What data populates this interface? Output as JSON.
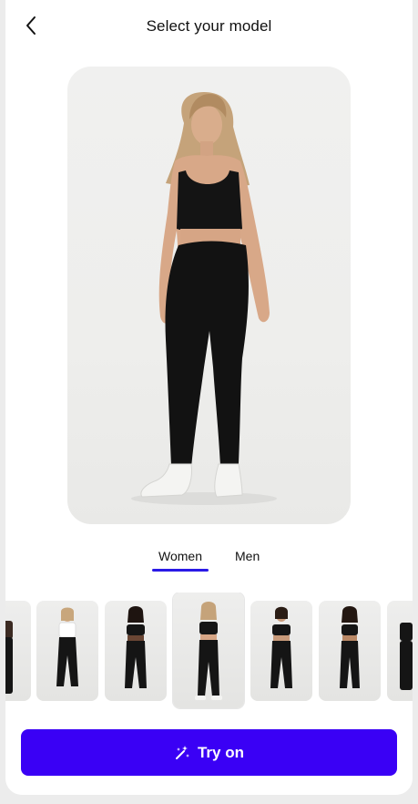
{
  "header": {
    "back_icon": "chevron-left-icon",
    "title": "Select your model"
  },
  "tabs": [
    {
      "label": "Women",
      "selected": true
    },
    {
      "label": "Men",
      "selected": false
    }
  ],
  "thumbnails": {
    "count_visible": 7,
    "selected_index": 3,
    "items": [
      {
        "outfit": "black"
      },
      {
        "outfit": "white-top-black-leggings"
      },
      {
        "outfit": "black"
      },
      {
        "outfit": "black",
        "selected": true
      },
      {
        "outfit": "black"
      },
      {
        "outfit": "black"
      },
      {
        "outfit": "black"
      }
    ]
  },
  "cta": {
    "label": "Try on",
    "icon": "magic-wand-icon",
    "color": "#3a00f5"
  },
  "colors": {
    "accent": "#2a1ae6",
    "background": "#ffffff"
  }
}
